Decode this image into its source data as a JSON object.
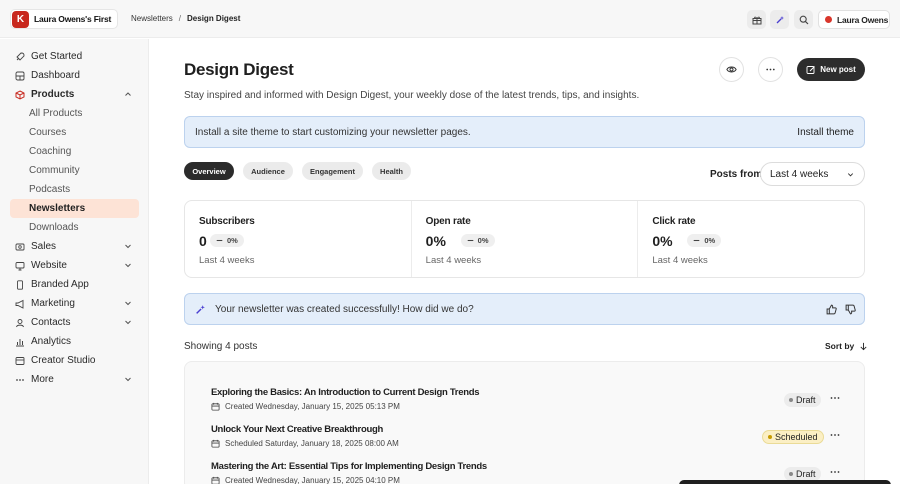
{
  "header": {
    "brand_initial": "K",
    "brand_name": "Laura Owens's First",
    "breadcrumb": [
      "Newsletters",
      "Design Digest"
    ],
    "breadcrumb_sep": "/",
    "icons": [
      "gift-icon",
      "sparkle-icon",
      "search-icon"
    ],
    "user_name": "Laura Owens",
    "accent": "#c8281e"
  },
  "sidebar": {
    "items": [
      {
        "label": "Get Started",
        "icon": "rocket-icon"
      },
      {
        "label": "Dashboard",
        "icon": "dashboard-icon"
      },
      {
        "label": "Products",
        "icon": "box-icon",
        "expanded": true
      },
      {
        "label": "Sales",
        "icon": "dollar-icon"
      },
      {
        "label": "Website",
        "icon": "monitor-icon"
      },
      {
        "label": "Branded App",
        "icon": "phone-icon"
      },
      {
        "label": "Marketing",
        "icon": "megaphone-icon"
      },
      {
        "label": "Contacts",
        "icon": "contacts-icon"
      },
      {
        "label": "Analytics",
        "icon": "chart-icon"
      },
      {
        "label": "Creator Studio",
        "icon": "studio-icon"
      },
      {
        "label": "More",
        "icon": "ellipsis-icon"
      }
    ],
    "products_sub": [
      "All Products",
      "Courses",
      "Coaching",
      "Community",
      "Podcasts",
      "Newsletters",
      "Downloads"
    ],
    "active_sub": "Newsletters",
    "active_color": "#fde3d6"
  },
  "main": {
    "title": "Design Digest",
    "subtitle": "Stay inspired and informed with Design Digest, your weekly dose of the latest trends, tips, and insights.",
    "new_post_label": "New post",
    "theme_banner": {
      "text": "Install a site theme to start customizing your newsletter pages.",
      "action": "Install theme"
    },
    "tabs": [
      {
        "label": "Overview",
        "active": true
      },
      {
        "label": "Audience",
        "active": false
      },
      {
        "label": "Engagement",
        "active": false
      },
      {
        "label": "Health",
        "active": false
      }
    ],
    "posts_from_label": "Posts from",
    "range_select": "Last 4 weeks",
    "stats": [
      {
        "label": "Subscribers",
        "value": "0",
        "change": "0%",
        "period": "Last 4 weeks"
      },
      {
        "label": "Open rate",
        "value": "0%",
        "change": "0%",
        "period": "Last 4 weeks"
      },
      {
        "label": "Click rate",
        "value": "0%",
        "change": "0%",
        "period": "Last 4 weeks"
      }
    ],
    "feedback_text": "Your newsletter was created successfully! How did we do?",
    "showing": "Showing 4 posts",
    "sort_label": "Sort by",
    "posts": [
      {
        "title": "Exploring the Basics: An Introduction to Current Design Trends",
        "meta": "Created Wednesday, January 15, 2025 05:13 PM",
        "status": "Draft"
      },
      {
        "title": "Unlock Your Next Creative Breakthrough",
        "meta": "Scheduled Saturday, January 18, 2025 08:00 AM",
        "status": "Scheduled"
      },
      {
        "title": "Mastering the Art: Essential Tips for Implementing Design Trends",
        "meta": "Created Wednesday, January 15, 2025 04:10 PM",
        "status": "Draft"
      }
    ]
  }
}
